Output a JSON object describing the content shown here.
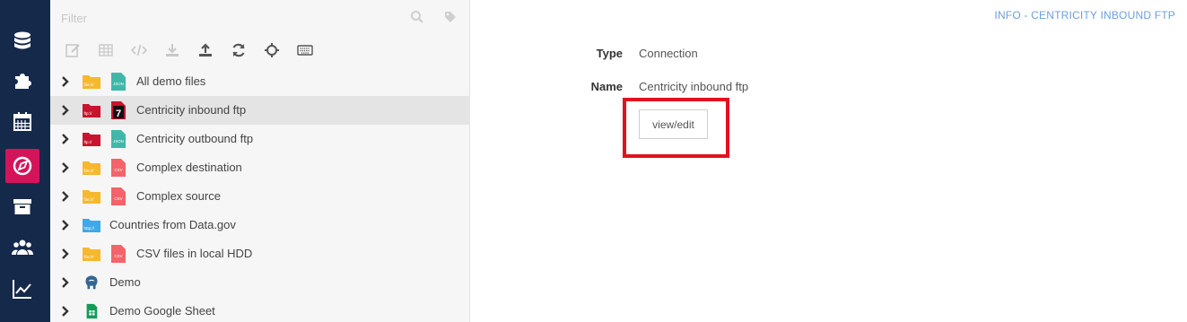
{
  "colors": {
    "rail": "#15294b",
    "active": "#d4145a",
    "highlight": "#e3101f",
    "link": "#6e9fd8"
  },
  "rail": {
    "items": [
      {
        "icon": "database-icon"
      },
      {
        "icon": "puzzle-icon"
      },
      {
        "icon": "calendar-icon"
      },
      {
        "icon": "compass-icon",
        "active": true
      },
      {
        "icon": "archive-icon"
      },
      {
        "icon": "users-icon"
      },
      {
        "icon": "chart-line-icon"
      }
    ]
  },
  "filter": {
    "placeholder": "Filter"
  },
  "toolbar": [
    "edit-icon",
    "grid-icon",
    "code-icon",
    "download-icon",
    "upload-icon",
    "refresh-icon",
    "crosshair-icon",
    "keyboard-icon"
  ],
  "tree": {
    "items": [
      {
        "label": "All demo files",
        "icon1": "folder-file-icon",
        "icon1_text": "file:///",
        "icon2": "json-file-icon",
        "icon2_text": "JSON"
      },
      {
        "label": "Centricity inbound ftp",
        "icon1": "folder-ftp-icon",
        "icon1_text": "ftp://",
        "icon2": "hl7-file-icon",
        "icon2_text": "7",
        "selected": true
      },
      {
        "label": "Centricity outbound ftp",
        "icon1": "folder-ftp-icon",
        "icon1_text": "ftp://",
        "icon2": "json-file-icon",
        "icon2_text": "JSON"
      },
      {
        "label": "Complex destination",
        "icon1": "folder-file-icon",
        "icon1_text": "file:///",
        "icon2": "csv-file-icon",
        "icon2_text": "CSV"
      },
      {
        "label": "Complex source",
        "icon1": "folder-file-icon",
        "icon1_text": "file:///",
        "icon2": "csv-file-icon",
        "icon2_text": "CSV"
      },
      {
        "label": "Countries from Data.gov",
        "icon1": "folder-http-icon",
        "icon1_text": "http://"
      },
      {
        "label": "CSV files in local HDD",
        "icon1": "folder-file-icon",
        "icon1_text": "file:///",
        "icon2": "csv-file-icon",
        "icon2_text": "CSV"
      },
      {
        "label": "Demo",
        "icon1": "postgres-icon"
      },
      {
        "label": "Demo Google Sheet",
        "icon1": "google-sheet-icon"
      }
    ]
  },
  "info": {
    "header": "INFO - CENTRICITY INBOUND FTP",
    "type_label": "Type",
    "type_value": "Connection",
    "name_label": "Name",
    "name_value": "Centricity inbound ftp",
    "button": "view/edit"
  }
}
